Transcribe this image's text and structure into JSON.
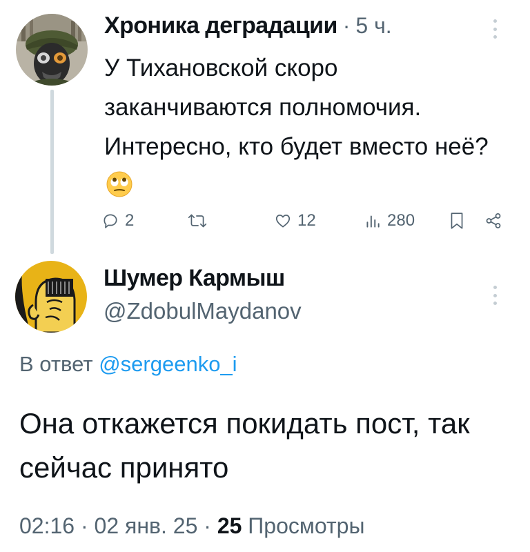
{
  "parent_tweet": {
    "author_name": "Хроника деградации",
    "separator": "·",
    "time": "5 ч.",
    "text": "У Тихановской скоро заканчиваются полномочия. Интересно, кто будет вместо неё?",
    "emoji": "face-with-rolling-eyes",
    "actions": {
      "replies": "2",
      "retweets": "",
      "likes": "12",
      "views": "280"
    }
  },
  "reply_tweet": {
    "author_name": "Шумер Кармыш",
    "handle": "@ZdobulMaydanov",
    "reply_prefix": "В ответ",
    "reply_mention": "@sergeenko_i",
    "text": "Она откажется покидать пост, так сейчас принято",
    "meta": {
      "time": "02:16",
      "sep1": "·",
      "date": "02 янв. 25",
      "sep2": "·",
      "views_count": "25",
      "views_label": "Просмотры"
    }
  },
  "colors": {
    "text_primary": "#0f1419",
    "text_secondary": "#536471",
    "link": "#1d9bf0",
    "thread_line": "#cfd9de"
  }
}
